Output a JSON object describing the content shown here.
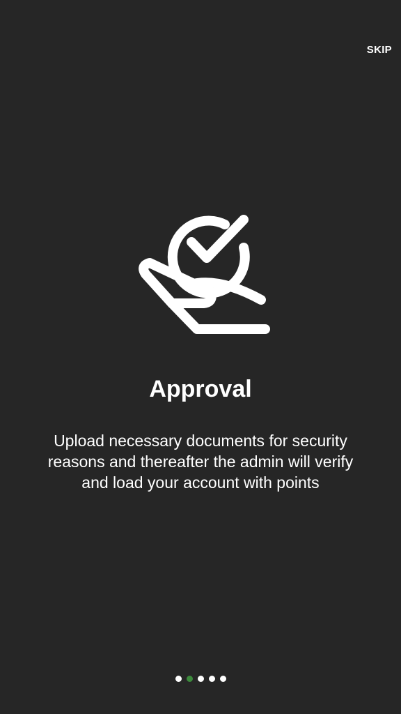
{
  "header": {
    "skip_label": "SKIP"
  },
  "slide": {
    "icon": "hand-check-approval-icon",
    "title": "Approval",
    "description": "Upload necessary documents for security reasons and thereafter the admin will verify and load your account with points"
  },
  "pager": {
    "total": 5,
    "active_index": 1,
    "active_color": "#3c8a3c",
    "inactive_color": "#ffffff"
  },
  "colors": {
    "background": "#262626",
    "foreground": "#ffffff"
  }
}
